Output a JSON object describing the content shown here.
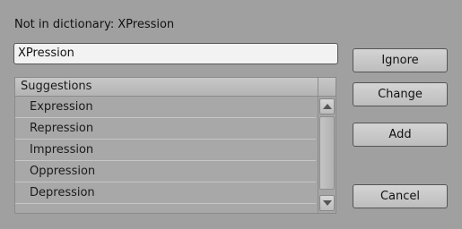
{
  "header": {
    "label": "Not in dictionary:",
    "word": "XPression"
  },
  "word_input": {
    "value": "XPression"
  },
  "suggestions": {
    "column_header": "Suggestions",
    "items": [
      "Expression",
      "Repression",
      "Impression",
      "Oppression",
      "Depression"
    ]
  },
  "buttons": {
    "ignore": "Ignore",
    "change": "Change",
    "add": "Add",
    "cancel": "Cancel"
  }
}
